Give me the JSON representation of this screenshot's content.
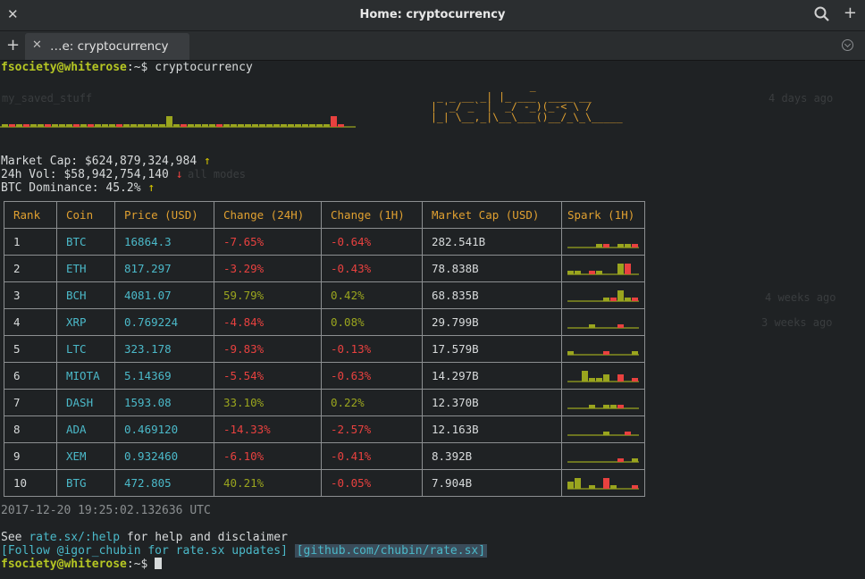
{
  "window": {
    "title": "Home: cryptocurrency"
  },
  "icons": {
    "close": "close-icon",
    "search": "search-icon",
    "add": "plus-icon",
    "tab_menu": "chevron-down-icon"
  },
  "tabbar": {
    "tab_label": "…e: cryptocurrency"
  },
  "terminal": {
    "prompt_user": "fsociety@whiterose",
    "prompt_rest": ":~$ ",
    "command": "cryptocurrency",
    "ascii_art": [
      "                _",
      " _ _ __ _| |_ ___  ____ __",
      "| '_/ _` |  _/ -_)(_-< \\ /",
      "|_| \\__,_|\\__\\___()__/_\\_\\_____"
    ],
    "market_cap_label": "Market Cap: ",
    "market_cap_value": "$624,879,324,984",
    "market_cap_arrow": "↑",
    "vol_label": "24h Vol: ",
    "vol_value": "$58,942,754,140",
    "vol_arrow": "↓",
    "dominance_label": "BTC Dominance: ",
    "dominance_value": "45.2%",
    "dominance_arrow": "↑",
    "timestamp": "2017-12-20 19:25:02.132636 UTC",
    "help_pre": "See ",
    "help_link": "rate.sx/:help",
    "help_post": " for help and disclaimer",
    "follow_text": "[Follow @igor_chubin for rate.sx updates]",
    "github_text": "[github.com/chubin/rate.sx]",
    "ghost_text": [
      "my_saved_stuff",
      "4 days ago",
      "3 weeks ago",
      "4 weeks ago",
      "all modes"
    ]
  },
  "table": {
    "headers": [
      "Rank",
      "Coin",
      "Price (USD)",
      "Change (24H)",
      "Change (1H)",
      "Market Cap (USD)",
      "Spark (1H)"
    ],
    "rows": [
      {
        "rank": "1",
        "coin": "BTC",
        "price": "16864.3",
        "ch24": "-7.65%",
        "ch1": "-0.64%",
        "mcap": "282.541B"
      },
      {
        "rank": "2",
        "coin": "ETH",
        "price": "817.297",
        "ch24": "-3.29%",
        "ch1": "-0.43%",
        "mcap": "78.838B"
      },
      {
        "rank": "3",
        "coin": "BCH",
        "price": "4081.07",
        "ch24": "59.79%",
        "ch1": "0.42%",
        "mcap": "68.835B"
      },
      {
        "rank": "4",
        "coin": "XRP",
        "price": "0.769224",
        "ch24": "-4.84%",
        "ch1": "0.08%",
        "mcap": "29.799B"
      },
      {
        "rank": "5",
        "coin": "LTC",
        "price": "323.178",
        "ch24": "-9.83%",
        "ch1": "-0.13%",
        "mcap": "17.579B"
      },
      {
        "rank": "6",
        "coin": "MIOTA",
        "price": "5.14369",
        "ch24": "-5.54%",
        "ch1": "-0.63%",
        "mcap": "14.297B"
      },
      {
        "rank": "7",
        "coin": "DASH",
        "price": "1593.08",
        "ch24": "33.10%",
        "ch1": "0.22%",
        "mcap": "12.370B"
      },
      {
        "rank": "8",
        "coin": "ADA",
        "price": "0.469120",
        "ch24": "-14.33%",
        "ch1": "-2.57%",
        "mcap": "12.163B"
      },
      {
        "rank": "9",
        "coin": "XEM",
        "price": "0.932460",
        "ch24": "-6.10%",
        "ch1": "-0.41%",
        "mcap": "8.392B"
      },
      {
        "rank": "10",
        "coin": "BTG",
        "price": "472.805",
        "ch24": "40.21%",
        "ch1": "-0.05%",
        "mcap": "7.904B"
      }
    ]
  },
  "colors": {
    "user": "#b5c623",
    "positive": "#9aa51e",
    "negative": "#e8413f",
    "accent": "#e0a030",
    "value": "#4bb9c9"
  },
  "top_spark": [
    1,
    -1,
    1,
    -1,
    1,
    1,
    -1,
    1,
    1,
    1,
    -1,
    1,
    -1,
    1,
    1,
    1,
    -1,
    1,
    1,
    1,
    1,
    1,
    1,
    4,
    1,
    -1,
    1,
    1,
    1,
    1,
    -1,
    1,
    1,
    1,
    1,
    1,
    1,
    1,
    1,
    1,
    1,
    1,
    1,
    1,
    1,
    1,
    -4,
    -1
  ],
  "row_sparks": [
    [
      0,
      0,
      0,
      0,
      1,
      -1,
      0,
      1,
      1,
      -1
    ],
    [
      1,
      1,
      0,
      -1,
      1,
      0,
      0,
      3,
      -3,
      0
    ],
    [
      0,
      0,
      0,
      0,
      0,
      1,
      -1,
      3,
      1,
      -1
    ],
    [
      0,
      0,
      0,
      1,
      0,
      0,
      0,
      -1,
      0,
      0
    ],
    [
      1,
      0,
      0,
      0,
      0,
      -1,
      0,
      0,
      0,
      1
    ],
    [
      0,
      0,
      3,
      1,
      1,
      2,
      0,
      -2,
      0,
      -1
    ],
    [
      0,
      0,
      0,
      1,
      0,
      1,
      1,
      -1,
      0,
      0
    ],
    [
      0,
      0,
      0,
      0,
      0,
      1,
      0,
      0,
      -1,
      0
    ],
    [
      0,
      0,
      0,
      0,
      0,
      0,
      0,
      -1,
      0,
      1
    ],
    [
      2,
      3,
      0,
      1,
      0,
      -3,
      1,
      0,
      0,
      -1
    ]
  ]
}
